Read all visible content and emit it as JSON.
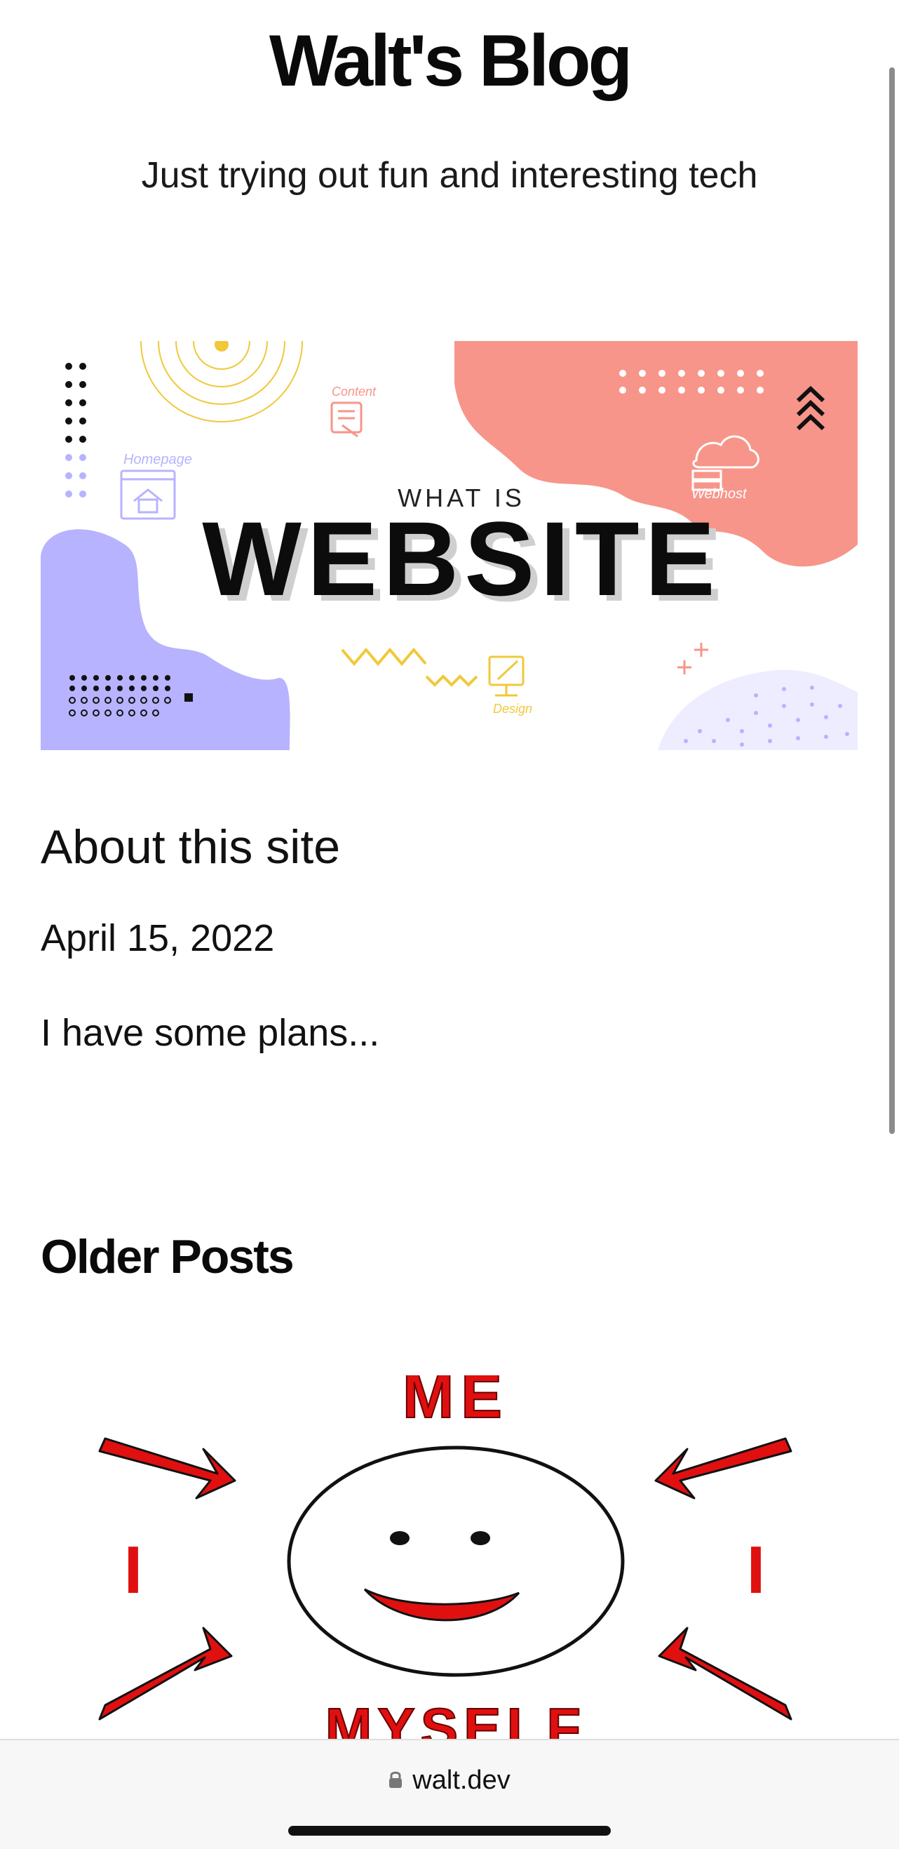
{
  "site": {
    "title": "Walt's Blog",
    "tagline": "Just trying out fun and interesting tech"
  },
  "hero_image": {
    "label_small": "WHAT IS",
    "label_big": "WEBSITE",
    "tag_homepage": "Homepage",
    "tag_content": "Content",
    "tag_webhost": "Webhost",
    "tag_design": "Design",
    "colors": {
      "salmon": "#f7958a",
      "lavender": "#b7b3ff",
      "yellow": "#f0c83a"
    }
  },
  "featured_post": {
    "title": "About this site",
    "date": "April 15, 2022",
    "excerpt": "I have some plans..."
  },
  "older_posts": {
    "heading": "Older Posts",
    "image": {
      "word_top": "ME",
      "word_bottom": "MYSELF",
      "word_side": "I",
      "accent": "#e01010"
    }
  },
  "browser": {
    "url": "walt.dev"
  }
}
